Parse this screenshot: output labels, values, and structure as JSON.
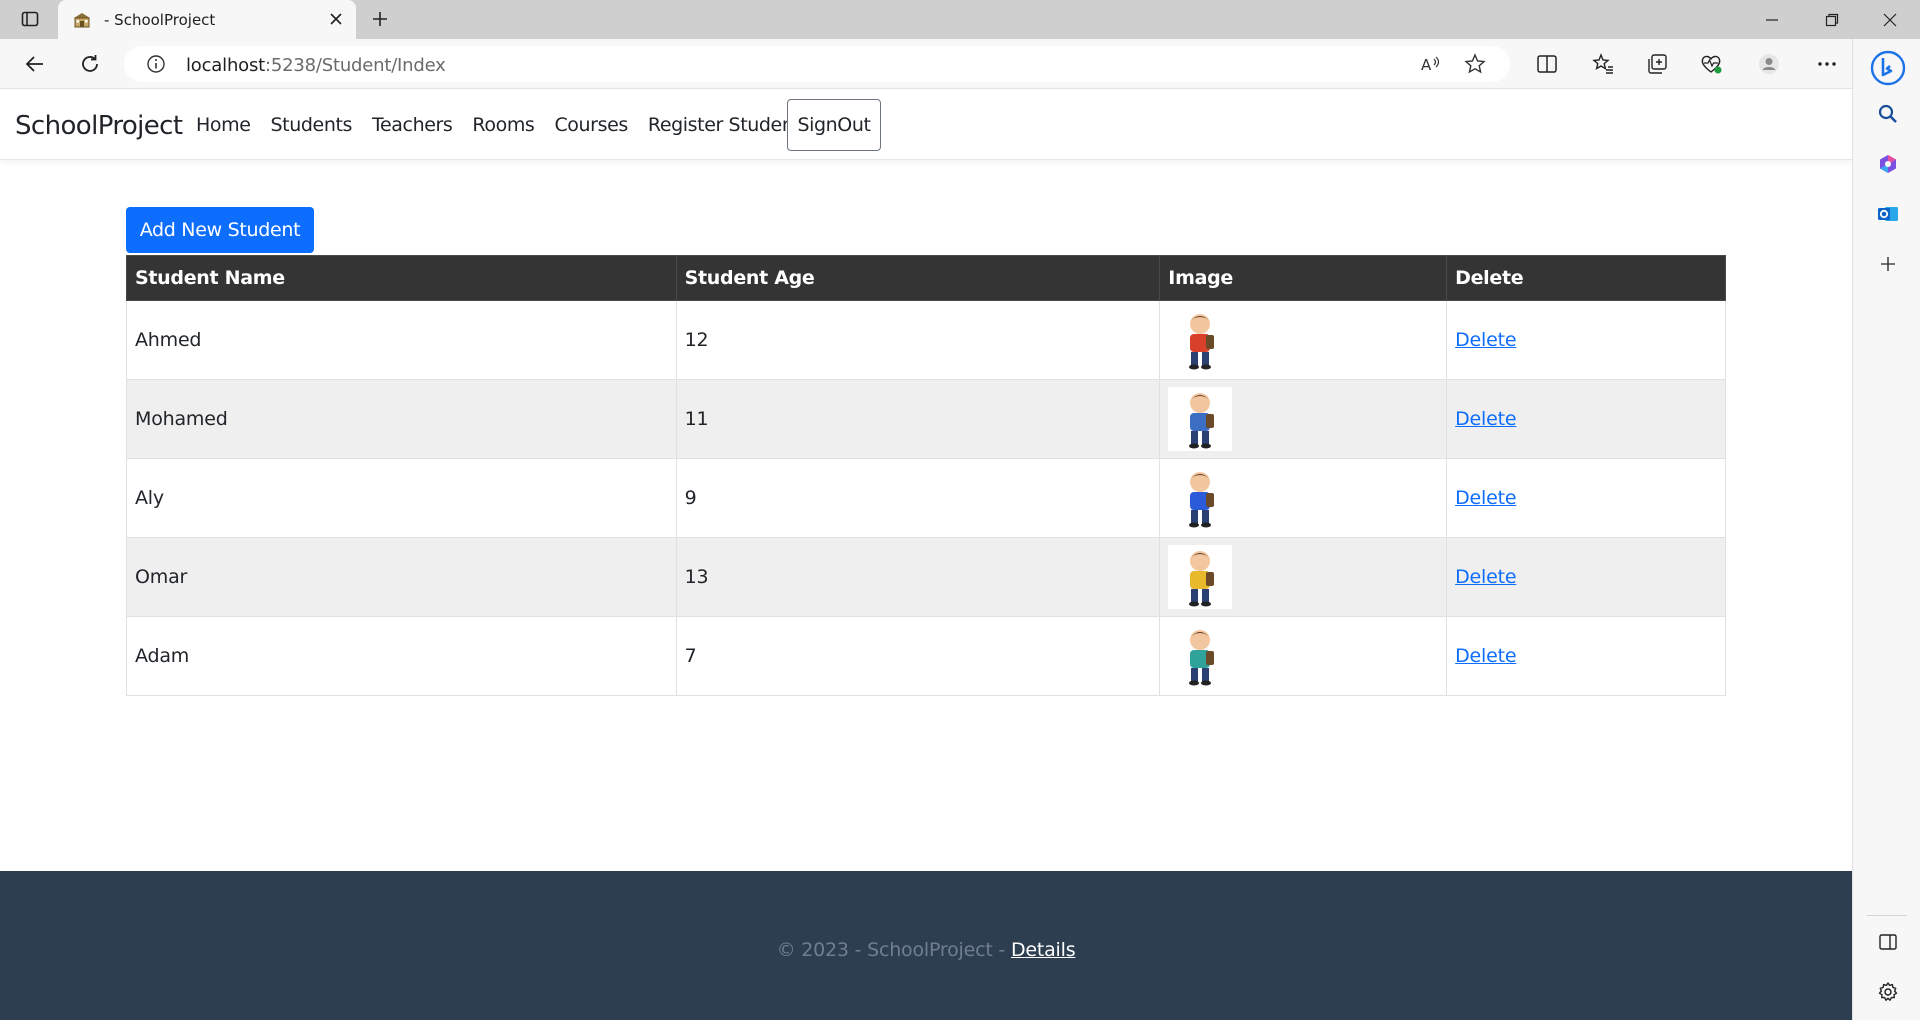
{
  "browser": {
    "tab_title": "- SchoolProject",
    "url_host": "localhost",
    "url_rest": ":5238/Student/Index"
  },
  "navbar": {
    "brand": "SchoolProject",
    "links": [
      "Home",
      "Students",
      "Teachers",
      "Rooms",
      "Courses",
      "Register Student"
    ],
    "signout": "SignOut"
  },
  "main": {
    "add_button": "Add New Student",
    "columns": [
      "Student Name",
      "Student Age",
      "Image",
      "Delete"
    ],
    "rows": [
      {
        "name": "Ahmed",
        "age": "12",
        "delete": "Delete",
        "avatar_color": "#d9402b"
      },
      {
        "name": "Mohamed",
        "age": "11",
        "delete": "Delete",
        "avatar_color": "#3c6ec4"
      },
      {
        "name": "Aly",
        "age": "9",
        "delete": "Delete",
        "avatar_color": "#2b5bd9"
      },
      {
        "name": "Omar",
        "age": "13",
        "delete": "Delete",
        "avatar_color": "#e8b92b"
      },
      {
        "name": "Adam",
        "age": "7",
        "delete": "Delete",
        "avatar_color": "#2fa39a"
      }
    ]
  },
  "footer": {
    "copyright": "© 2023 - SchoolProject - ",
    "link": "Details"
  },
  "colors": {
    "primary": "#0d6efd",
    "table_header": "#343434",
    "footer_bg": "#2c3e50"
  }
}
